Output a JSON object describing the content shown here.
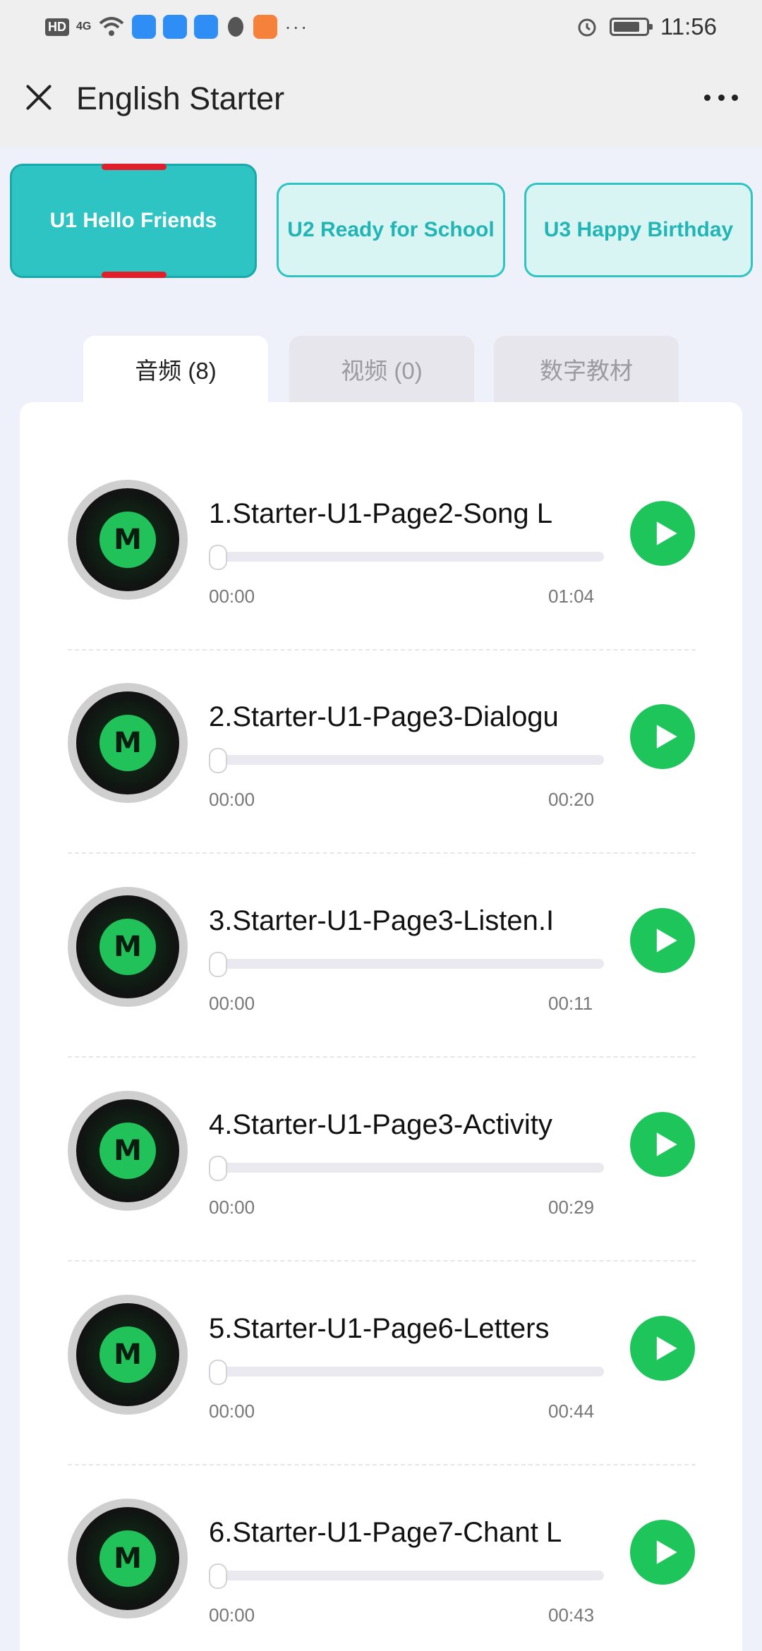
{
  "status_bar": {
    "hd": "HD",
    "signal": "4G",
    "more": "···",
    "time": "11:56"
  },
  "header": {
    "title": "English Starter"
  },
  "unit_tabs": [
    {
      "label": "U1 Hello Friends",
      "active": true
    },
    {
      "label": "U2 Ready for School",
      "active": false
    },
    {
      "label": "U3 Happy Birthday",
      "active": false
    }
  ],
  "media_tabs": [
    {
      "label": "音频 (8)",
      "active": true
    },
    {
      "label": "视频 (0)",
      "active": false
    },
    {
      "label": "数字教材",
      "active": false
    }
  ],
  "tracks": [
    {
      "disc_letter": "M",
      "title": "1.Starter-U1-Page2-Song L",
      "elapsed": "00:00",
      "duration": "01:04",
      "progress": 0
    },
    {
      "disc_letter": "M",
      "title": "2.Starter-U1-Page3-Dialogu",
      "elapsed": "00:00",
      "duration": "00:20",
      "progress": 0
    },
    {
      "disc_letter": "M",
      "title": "3.Starter-U1-Page3-Listen.I",
      "elapsed": "00:00",
      "duration": "00:11",
      "progress": 0
    },
    {
      "disc_letter": "M",
      "title": "4.Starter-U1-Page3-Activity",
      "elapsed": "00:00",
      "duration": "00:29",
      "progress": 0
    },
    {
      "disc_letter": "M",
      "title": "5.Starter-U1-Page6-Letters",
      "elapsed": "00:00",
      "duration": "00:44",
      "progress": 0
    },
    {
      "disc_letter": "M",
      "title": "6.Starter-U1-Page7-Chant L",
      "elapsed": "00:00",
      "duration": "00:43",
      "progress": 0
    }
  ],
  "colors": {
    "accent_teal": "#2ec4c4",
    "play_green": "#1ec55a",
    "marker_red": "#e01f2b"
  }
}
